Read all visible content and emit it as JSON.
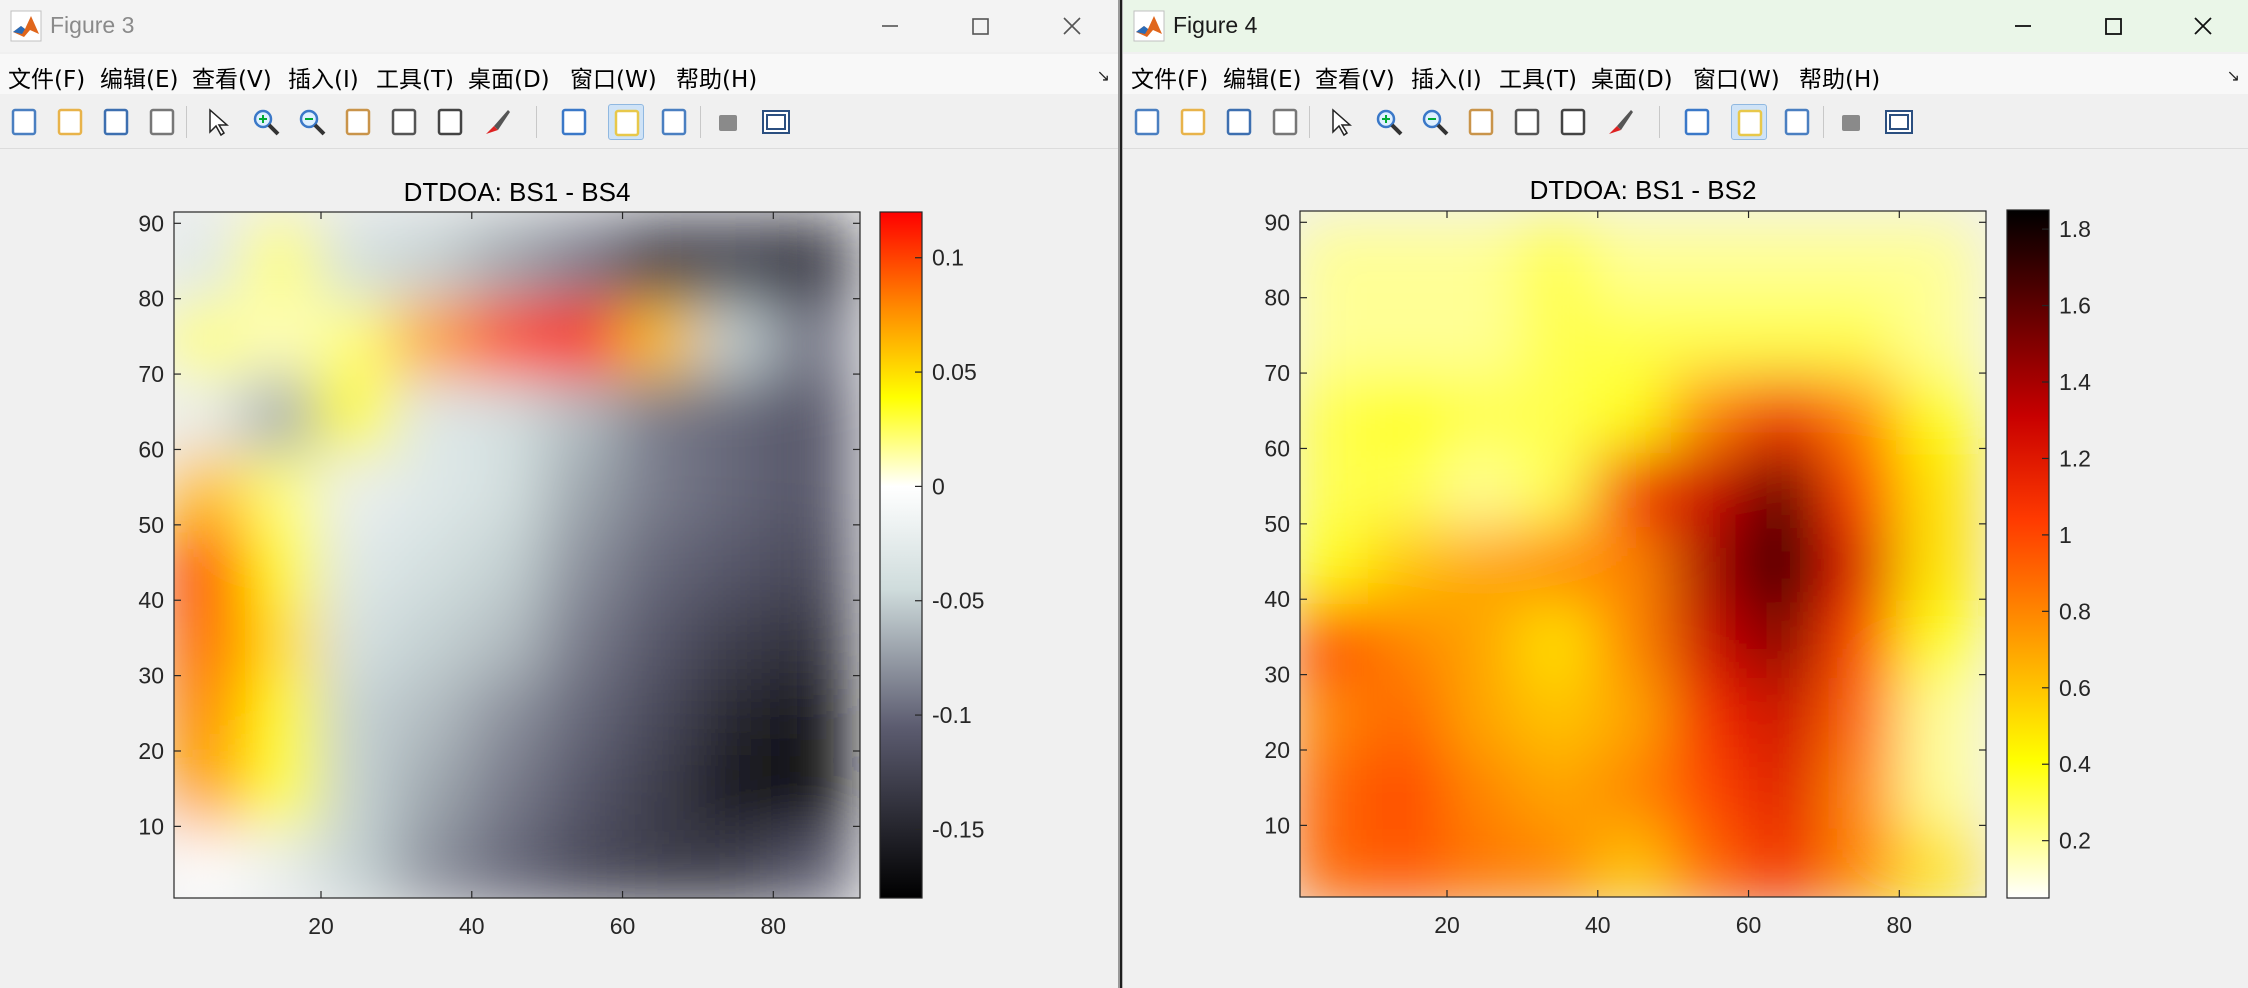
{
  "menu_labels": [
    "文件(F)",
    "编辑(E)",
    "查看(V)",
    "插入(I)",
    "工具(T)",
    "桌面(D)",
    "窗口(W)",
    "帮助(H)"
  ],
  "toolbar_icons": [
    "new-figure-icon",
    "open-file-icon",
    "save-icon",
    "print-icon",
    "select-arrow-icon",
    "zoom-in-icon",
    "zoom-out-icon",
    "pan-icon",
    "rotate-3d-icon",
    "data-cursor-icon",
    "brush-icon",
    "link-plot-icon",
    "colorbar-icon",
    "legend-icon",
    "hide-plot-tools-icon",
    "show-plot-tools-icon"
  ],
  "windows": [
    {
      "title": "Figure 3",
      "focused": false,
      "titlebar_color": "#f3f3f3",
      "chart": {
        "title": "DTDOA: BS1 - BS4",
        "colormap": "bone",
        "x_ticks": [
          "20",
          "40",
          "60",
          "80"
        ],
        "y_ticks": [
          "10",
          "20",
          "30",
          "40",
          "50",
          "60",
          "70",
          "80",
          "90"
        ],
        "colorbar_ticks": [
          "0.1",
          "0.05",
          "0",
          "-0.05",
          "-0.1",
          "-0.15"
        ]
      }
    },
    {
      "title": "Figure 4",
      "focused": true,
      "titlebar_color": "#eaf6e8",
      "chart": {
        "title": "DTDOA: BS1 - BS2",
        "colormap": "hot",
        "x_ticks": [
          "20",
          "40",
          "60",
          "80"
        ],
        "y_ticks": [
          "10",
          "20",
          "30",
          "40",
          "50",
          "60",
          "70",
          "80",
          "90"
        ],
        "colorbar_ticks": [
          "1.8",
          "1.6",
          "1.4",
          "1.2",
          "1",
          "0.8",
          "0.6",
          "0.4",
          "0.2"
        ]
      }
    }
  ],
  "chart_data": [
    {
      "type": "heatmap",
      "title": "DTDOA: BS1 - BS4",
      "xlim": [
        0.5,
        91.5
      ],
      "ylim": [
        0.5,
        91.5
      ],
      "clim": [
        -0.18,
        0.12
      ],
      "grid_x": [
        5,
        15,
        25,
        35,
        45,
        55,
        65,
        75,
        85
      ],
      "grid_y": [
        5,
        15,
        25,
        35,
        45,
        55,
        65,
        75,
        85
      ],
      "values": [
        [
          0.0,
          -0.02,
          -0.05,
          -0.08,
          -0.1,
          -0.12,
          -0.13,
          -0.13,
          -0.11
        ],
        [
          0.07,
          0.03,
          -0.05,
          -0.07,
          -0.09,
          -0.11,
          -0.13,
          -0.16,
          -0.17
        ],
        [
          0.08,
          0.04,
          -0.05,
          -0.06,
          -0.08,
          -0.1,
          -0.12,
          -0.15,
          -0.16
        ],
        [
          0.09,
          0.05,
          -0.04,
          -0.05,
          -0.06,
          -0.09,
          -0.11,
          -0.13,
          -0.14
        ],
        [
          0.1,
          0.04,
          -0.03,
          -0.04,
          -0.05,
          -0.08,
          -0.1,
          -0.11,
          -0.12
        ],
        [
          0.06,
          0.02,
          -0.02,
          -0.03,
          -0.04,
          -0.07,
          -0.09,
          -0.1,
          -0.11
        ],
        [
          -0.02,
          -0.07,
          0.04,
          -0.03,
          -0.04,
          -0.06,
          -0.09,
          -0.1,
          -0.11
        ],
        [
          0.02,
          0.01,
          0.02,
          0.07,
          0.1,
          0.11,
          0.06,
          -0.05,
          -0.09
        ],
        [
          -0.03,
          0.02,
          -0.04,
          -0.05,
          -0.07,
          -0.09,
          -0.13,
          -0.13,
          -0.14
        ]
      ],
      "colorbar_ticks": [
        0.1,
        0.05,
        0,
        -0.05,
        -0.1,
        -0.15
      ]
    },
    {
      "type": "heatmap",
      "title": "DTDOA: BS1 - BS2",
      "xlim": [
        0.5,
        91.5
      ],
      "ylim": [
        0.5,
        91.5
      ],
      "clim": [
        0.05,
        1.85
      ],
      "grid_x": [
        5,
        15,
        25,
        35,
        45,
        55,
        65,
        75,
        85
      ],
      "grid_y": [
        5,
        15,
        25,
        35,
        45,
        55,
        65,
        75,
        85
      ],
      "values": [
        [
          0.9,
          0.95,
          0.85,
          0.8,
          0.6,
          0.9,
          1.1,
          0.8,
          0.5
        ],
        [
          0.9,
          1.0,
          0.8,
          0.7,
          0.8,
          1.0,
          1.2,
          0.8,
          0.2
        ],
        [
          0.8,
          0.9,
          0.7,
          0.6,
          0.7,
          1.1,
          1.3,
          0.9,
          0.2
        ],
        [
          1.0,
          0.8,
          0.7,
          0.5,
          0.8,
          1.3,
          1.5,
          1.0,
          0.4
        ],
        [
          0.4,
          0.6,
          0.7,
          0.8,
          0.8,
          1.4,
          1.8,
          1.2,
          0.5
        ],
        [
          0.3,
          0.3,
          0.2,
          0.3,
          1.1,
          1.3,
          1.6,
          1.0,
          0.5
        ],
        [
          0.3,
          0.4,
          0.3,
          0.3,
          0.4,
          0.8,
          1.1,
          0.8,
          0.4
        ],
        [
          0.2,
          0.2,
          0.2,
          0.3,
          0.3,
          0.3,
          0.3,
          0.3,
          0.2
        ],
        [
          0.2,
          0.2,
          0.2,
          0.3,
          0.2,
          0.2,
          0.2,
          0.2,
          0.2
        ]
      ],
      "colorbar_ticks": [
        1.8,
        1.6,
        1.4,
        1.2,
        1,
        0.8,
        0.6,
        0.4,
        0.2
      ]
    }
  ]
}
